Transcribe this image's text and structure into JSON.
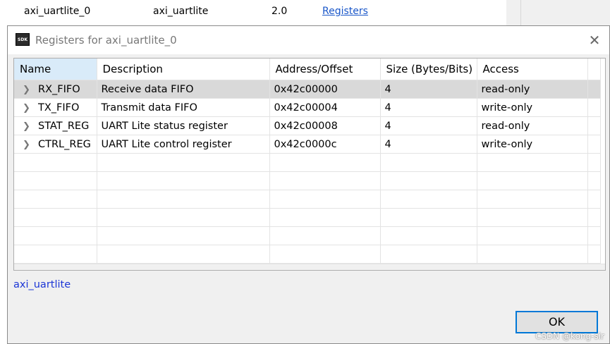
{
  "background_row": {
    "name": "axi_uartlite_0",
    "type": "axi_uartlite",
    "version": "2.0",
    "link": "Registers"
  },
  "dialog": {
    "icon_text": "SDK",
    "title": "Registers for axi_uartlite_0",
    "close_glyph": "✕",
    "columns": [
      "Name",
      "Description",
      "Address/Offset",
      "Size (Bytes/Bits)",
      "Access"
    ],
    "rows": [
      {
        "name": "RX_FIFO",
        "description": "Receive data FIFO",
        "address": "0x42c00000",
        "size": "4",
        "access": "read-only"
      },
      {
        "name": "TX_FIFO",
        "description": "Transmit data FIFO",
        "address": "0x42c00004",
        "size": "4",
        "access": "write-only"
      },
      {
        "name": "STAT_REG",
        "description": "UART Lite status register",
        "address": "0x42c00008",
        "size": "4",
        "access": "read-only"
      },
      {
        "name": "CTRL_REG",
        "description": "UART Lite control register",
        "address": "0x42c0000c",
        "size": "4",
        "access": "write-only"
      }
    ],
    "footer_label": "axi_uartlite",
    "ok_label": "OK"
  },
  "watermark": "CSDN @kong-sir",
  "colors": {
    "link": "#1a57c9",
    "footer_label": "#1c36d6",
    "selected_row": "#d9d9d9",
    "sorted_header": "#d9ebf9",
    "ok_border": "#0078d7"
  }
}
